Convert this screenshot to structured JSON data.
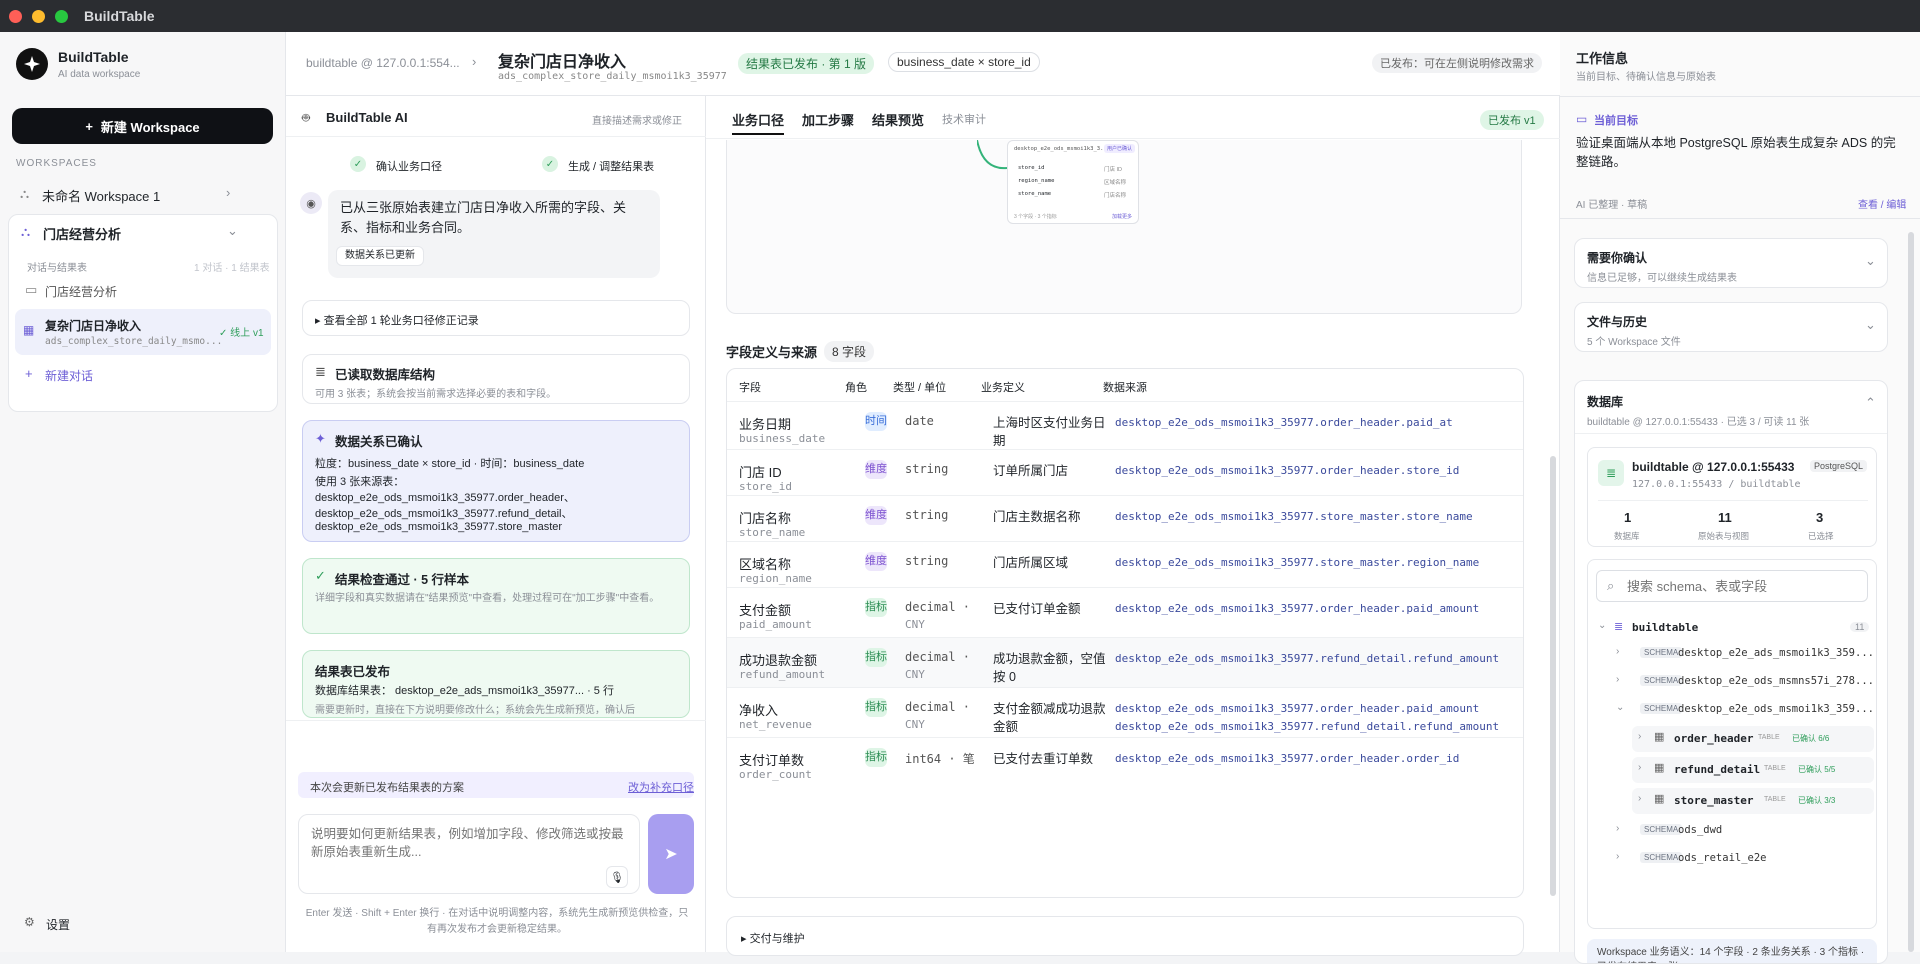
{
  "window": {
    "title": "BuildTable"
  },
  "sidebar": {
    "brand": "BuildTable",
    "brand_sub": "AI data workspace",
    "new_workspace": "新建 Workspace",
    "workspaces_label": "WORKSPACES",
    "ws1": "未命名 Workspace 1",
    "ws2": "门店经营分析",
    "conv_label": "对话与结果表",
    "conv_counts": "1 对话 · 1 结果表",
    "conv1": "门店经营分析",
    "conv2_title": "复杂门店日净收入",
    "conv2_sub": "ads_complex_store_daily_msmo...",
    "conv2_badge": "线上 v1",
    "new_conv": "新建对话",
    "settings": "设置"
  },
  "header": {
    "crumb": "buildtable @ 127.0.0.1:554...",
    "title": "复杂门店日净收入",
    "subtitle": "ads_complex_store_daily_msmoi1k3_35977",
    "status": "结果表已发布 · 第 1 版",
    "grain": "business_date × store_id",
    "published_hint": "已发布：可在左侧说明修改需求"
  },
  "chat": {
    "title": "BuildTable AI",
    "hint": "直接描述需求或修正",
    "step1": "确认业务口径",
    "step2": "生成 / 调整结果表",
    "msg1": "已从三张原始表建立门店日净收入所需的字段、关系、指标和业务合同。",
    "msg1_btn": "数据关系已更新",
    "history": "▸ 查看全部 1 轮业务口径修正记录",
    "db_title": "已读取数据库结构",
    "db_desc": "可用 3 张表；系统会按当前需求选择必要的表和字段。",
    "rel_title": "数据关系已确认",
    "rel_l1": "粒度：business_date × store_id · 时间：business_date",
    "rel_l2": "使用 3 张来源表：",
    "rel_l3": "desktop_e2e_ods_msmoi1k3_35977.order_header、",
    "rel_l4": "desktop_e2e_ods_msmoi1k3_35977.refund_detail、",
    "rel_l5": "desktop_e2e_ods_msmoi1k3_35977.store_master",
    "check_title": "结果检查通过 · 5 行样本",
    "check_desc": "详细字段和真实数据请在\"结果预览\"中查看，处理过程可在\"加工步骤\"中查看。",
    "pub_title": "结果表已发布",
    "pub_l1": "数据库结果表： desktop_e2e_ads_msmoi1k3_35977... · 5 行",
    "pub_l2": "需要更新时，直接在下方说明要修改什么；系统会先生成新预览，确认后",
    "update_note": "本次会更新已发布结果表的方案",
    "update_link": "改为补充口径",
    "input_placeholder": "说明要如何更新结果表，例如增加字段、修改筛选或按最新原始表重新生成...",
    "footer": "Enter 发送 · Shift + Enter 换行 · 在对话中说明调整内容，系统先生成新预览供检查，只有再次发布才会更新稳定结果。"
  },
  "main": {
    "tabs": [
      "业务口径",
      "加工步骤",
      "结果预览",
      "技术审计"
    ],
    "version": "已发布 v1",
    "fields_title": "字段定义与来源",
    "fields_count": "8 字段",
    "columns": [
      "字段",
      "角色",
      "类型 / 单位",
      "业务定义",
      "数据来源"
    ],
    "rows": [
      {
        "name": "业务日期",
        "code": "business_date",
        "role": "时间",
        "rc": "time",
        "type": "date",
        "unit": "",
        "def": "上海时区支付业务日期",
        "src": [
          "desktop_e2e_ods_msmoi1k3_35977.order_header.paid_at"
        ]
      },
      {
        "name": "门店 ID",
        "code": "store_id",
        "role": "维度",
        "rc": "dim",
        "type": "string",
        "unit": "",
        "def": "订单所属门店",
        "src": [
          "desktop_e2e_ods_msmoi1k3_35977.order_header.store_id"
        ]
      },
      {
        "name": "门店名称",
        "code": "store_name",
        "role": "维度",
        "rc": "dim",
        "type": "string",
        "unit": "",
        "def": "门店主数据名称",
        "src": [
          "desktop_e2e_ods_msmoi1k3_35977.store_master.store_name"
        ]
      },
      {
        "name": "区域名称",
        "code": "region_name",
        "role": "维度",
        "rc": "dim",
        "type": "string",
        "unit": "",
        "def": "门店所属区域",
        "src": [
          "desktop_e2e_ods_msmoi1k3_35977.store_master.region_name"
        ]
      },
      {
        "name": "支付金额",
        "code": "paid_amount",
        "role": "指标",
        "rc": "met",
        "type": "decimal ·",
        "unit": "CNY",
        "def": "已支付订单金额",
        "src": [
          "desktop_e2e_ods_msmoi1k3_35977.order_header.paid_amount"
        ]
      },
      {
        "name": "成功退款金额",
        "code": "refund_amount",
        "role": "指标",
        "rc": "met",
        "type": "decimal ·",
        "unit": "CNY",
        "def": "成功退款金额，空值按 0",
        "src": [
          "desktop_e2e_ods_msmoi1k3_35977.refund_detail.refund_amount"
        ]
      },
      {
        "name": "净收入",
        "code": "net_revenue",
        "role": "指标",
        "rc": "met",
        "type": "decimal ·",
        "unit": "CNY",
        "def": "支付金额减成功退款金额",
        "src": [
          "desktop_e2e_ods_msmoi1k3_35977.order_header.paid_amount",
          "desktop_e2e_ods_msmoi1k3_35977.refund_detail.refund_amount"
        ]
      },
      {
        "name": "支付订单数",
        "code": "order_count",
        "role": "指标",
        "rc": "met",
        "type": "int64 · 笔",
        "unit": "",
        "def": "已支付去重订单数",
        "src": [
          "desktop_e2e_ods_msmoi1k3_35977.order_header.order_id"
        ]
      }
    ],
    "delivery": "▸ 交付与维护",
    "mini": {
      "name": "desktop_e2e_ods_msmoi1k3_3...",
      "badge": "用户已确认",
      "f1": "store_id",
      "f2": "region_name",
      "f3": "store_name",
      "f1r": "门店 ID",
      "f2r": "区域名称",
      "f3r": "门店名称",
      "foot": "3 个字段 · 3 个指标",
      "foot_link": "加载更多"
    }
  },
  "right": {
    "title": "工作信息",
    "sub": "当前目标、待确认信息与原始表",
    "goal_label": "当前目标",
    "goal": "验证桌面端从本地 PostgreSQL 原始表生成复杂 ADS 的完整链路。",
    "ai_note": "AI 已整理 · 草稿",
    "edit": "查看 / 编辑",
    "confirm_title": "需要你确认",
    "confirm_sub": "信息已足够，可以继续生成结果表",
    "files_title": "文件与历史",
    "files_sub": "5 个 Workspace 文件",
    "db_title": "数据库",
    "db_sub": "buildtable @ 127.0.0.1:55433 · 已选 3 / 可读 11 张",
    "conn_name": "buildtable @ 127.0.0.1:55433",
    "conn_tag": "PostgreSQL",
    "conn_sub": "127.0.0.1:55433 / buildtable",
    "stats": [
      {
        "v": "1",
        "l": "数据库"
      },
      {
        "v": "11",
        "l": "原始表与视图"
      },
      {
        "v": "3",
        "l": "已选择"
      }
    ],
    "search_placeholder": "搜索 schema、表或字段",
    "root": "buildtable",
    "root_count": "11",
    "schema_tag": "SCHEMA",
    "table_tag": "TABLE",
    "schemas": [
      "desktop_e2e_ads_msmoi1k3_359...",
      "desktop_e2e_ods_msmns57i_278...",
      "desktop_e2e_ods_msmoi1k3_359..."
    ],
    "tables": [
      {
        "n": "order_header",
        "s": "已确认 6/6"
      },
      {
        "n": "refund_detail",
        "s": "已确认 5/5"
      },
      {
        "n": "store_master",
        "s": "已确认 3/3"
      }
    ],
    "schemas2": [
      "ods_dwd",
      "ods_retail_e2e"
    ],
    "footnote": "Workspace 业务语义：14 个字段 · 2 条业务关系 · 3 个指标 · 已发布结果表 1 张"
  },
  "colors": {
    "accent": "#6d5fd6",
    "green": "#2f9e5b",
    "dark": "#0f1115"
  }
}
